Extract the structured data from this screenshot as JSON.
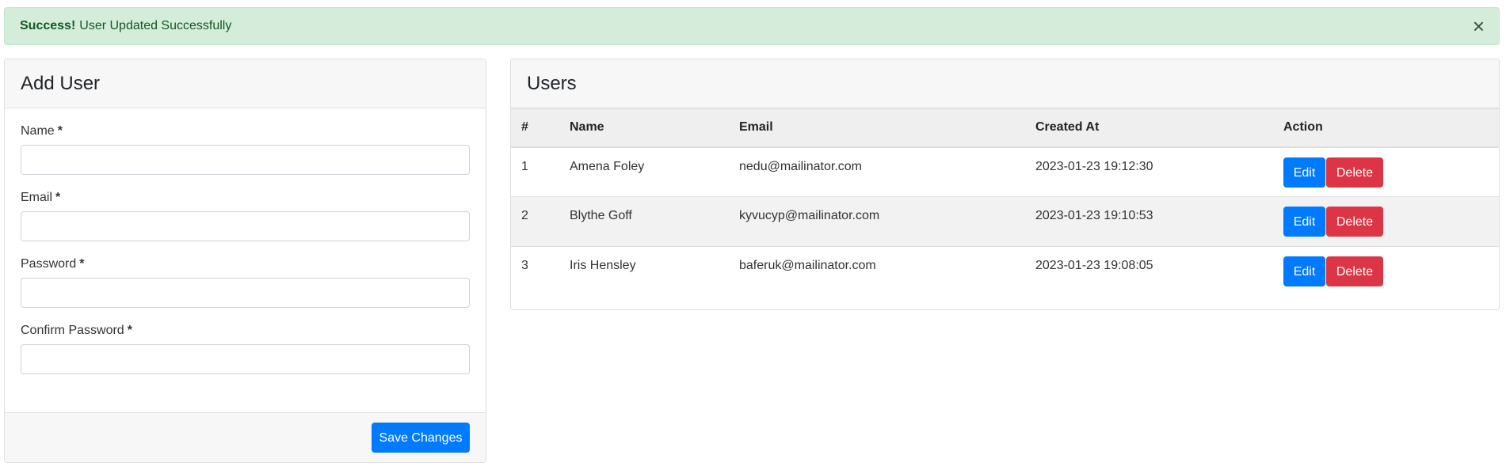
{
  "alert": {
    "strong": "Success!",
    "message": "User Updated Successfully",
    "close_symbol": "×"
  },
  "add_user": {
    "title": "Add User",
    "fields": [
      {
        "label": "Name",
        "required_mark": "*",
        "value": "",
        "placeholder": ""
      },
      {
        "label": "Email",
        "required_mark": "*",
        "value": "",
        "placeholder": ""
      },
      {
        "label": "Password",
        "required_mark": "*",
        "value": "",
        "placeholder": ""
      },
      {
        "label": "Confirm Password",
        "required_mark": "*",
        "value": "",
        "placeholder": ""
      }
    ],
    "save_label": "Save Changes"
  },
  "users": {
    "title": "Users",
    "columns": [
      "#",
      "Name",
      "Email",
      "Created At",
      "Action"
    ],
    "rows": [
      {
        "num": "1",
        "name": "Amena Foley",
        "email": "nedu@mailinator.com",
        "created_at": "2023-01-23 19:12:30"
      },
      {
        "num": "2",
        "name": "Blythe Goff",
        "email": "kyvucyp@mailinator.com",
        "created_at": "2023-01-23 19:10:53"
      },
      {
        "num": "3",
        "name": "Iris Hensley",
        "email": "baferuk@mailinator.com",
        "created_at": "2023-01-23 19:08:05"
      }
    ],
    "edit_label": "Edit",
    "delete_label": "Delete"
  },
  "colors": {
    "primary": "#007bff",
    "danger": "#dc3545",
    "success_bg": "#d4edda",
    "success_text": "#155724"
  }
}
